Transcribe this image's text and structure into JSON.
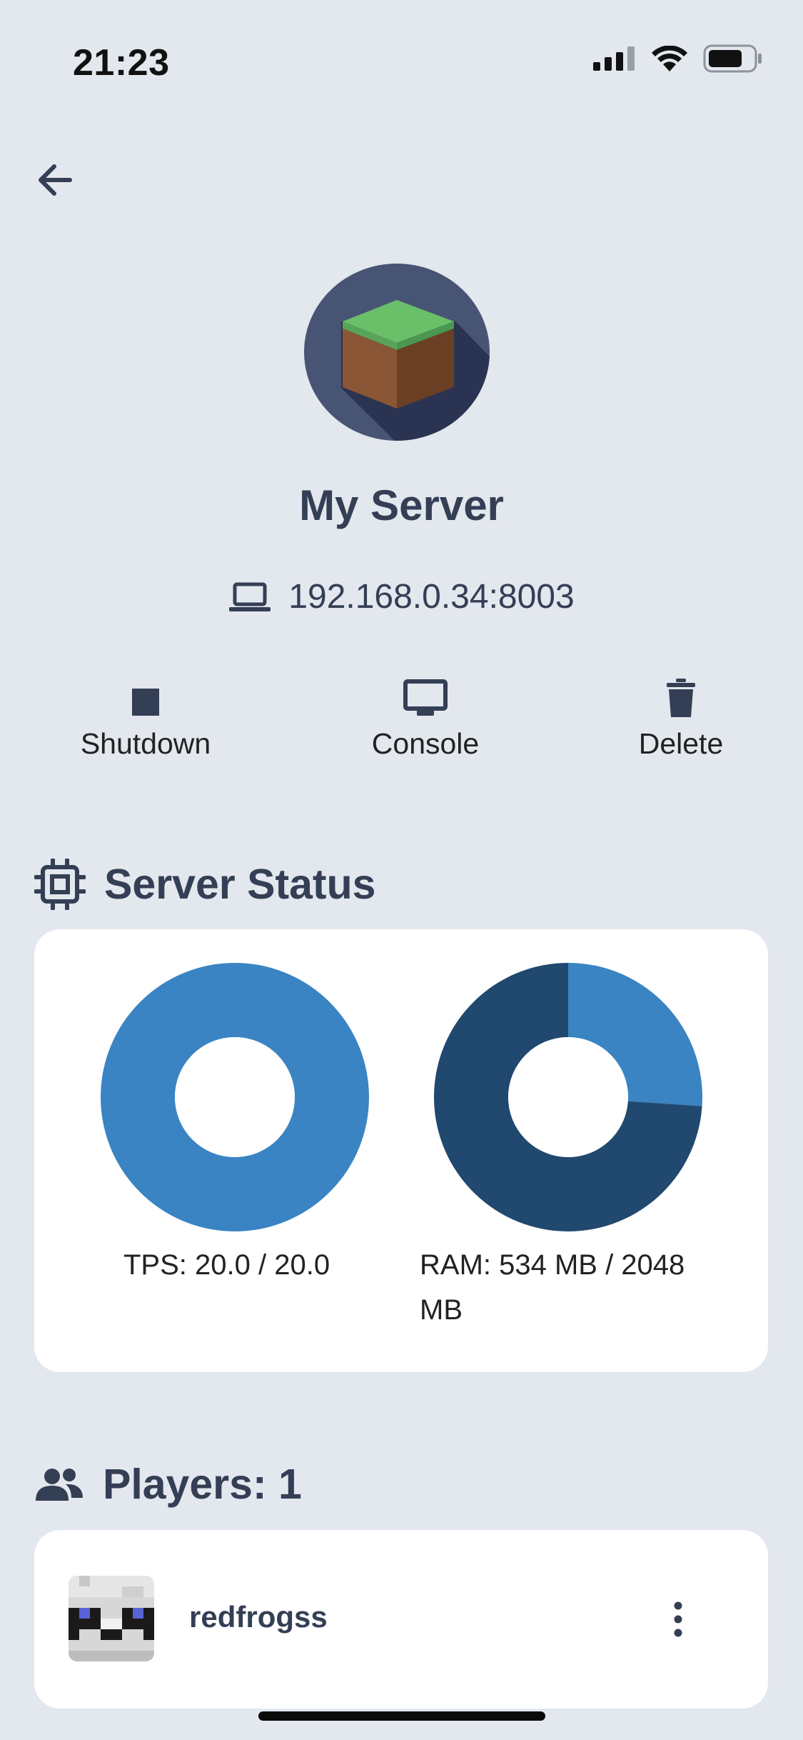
{
  "status_bar": {
    "time": "21:23",
    "icons": [
      "signal-icon",
      "wifi-icon",
      "battery-icon"
    ]
  },
  "server": {
    "name": "My Server",
    "address": "192.168.0.34:8003",
    "avatar_icon": "grass-block-icon"
  },
  "actions": [
    {
      "label": "Shutdown",
      "icon": "stop-icon"
    },
    {
      "label": "Console",
      "icon": "monitor-icon"
    },
    {
      "label": "Delete",
      "icon": "trash-icon"
    }
  ],
  "status_section": {
    "title": "Server Status",
    "icon": "cpu-chip-icon"
  },
  "chart_data": [
    {
      "type": "pie",
      "subtype": "donut",
      "label": "TPS: 20.0 / 20.0",
      "slices": [
        {
          "name": "used",
          "value": 20.0,
          "color": "#3a84c3"
        },
        {
          "name": "free",
          "value": 0.0,
          "color": "#21486e"
        }
      ]
    },
    {
      "type": "pie",
      "subtype": "donut",
      "label": "RAM: 534 MB / 2048 MB",
      "slices": [
        {
          "name": "used",
          "value": 534,
          "color": "#3a84c3"
        },
        {
          "name": "free",
          "value": 1514,
          "color": "#21486e"
        }
      ]
    }
  ],
  "players_section": {
    "title": "Players: 1",
    "icon": "users-icon",
    "players": [
      {
        "name": "redfrogss",
        "avatar_icon": "panda-skin-icon"
      }
    ]
  },
  "colors": {
    "background": "#e3e7ee",
    "text": "#343f55",
    "card": "#ffffff",
    "accent_light": "#3a84c3",
    "accent_dark": "#21486e"
  }
}
